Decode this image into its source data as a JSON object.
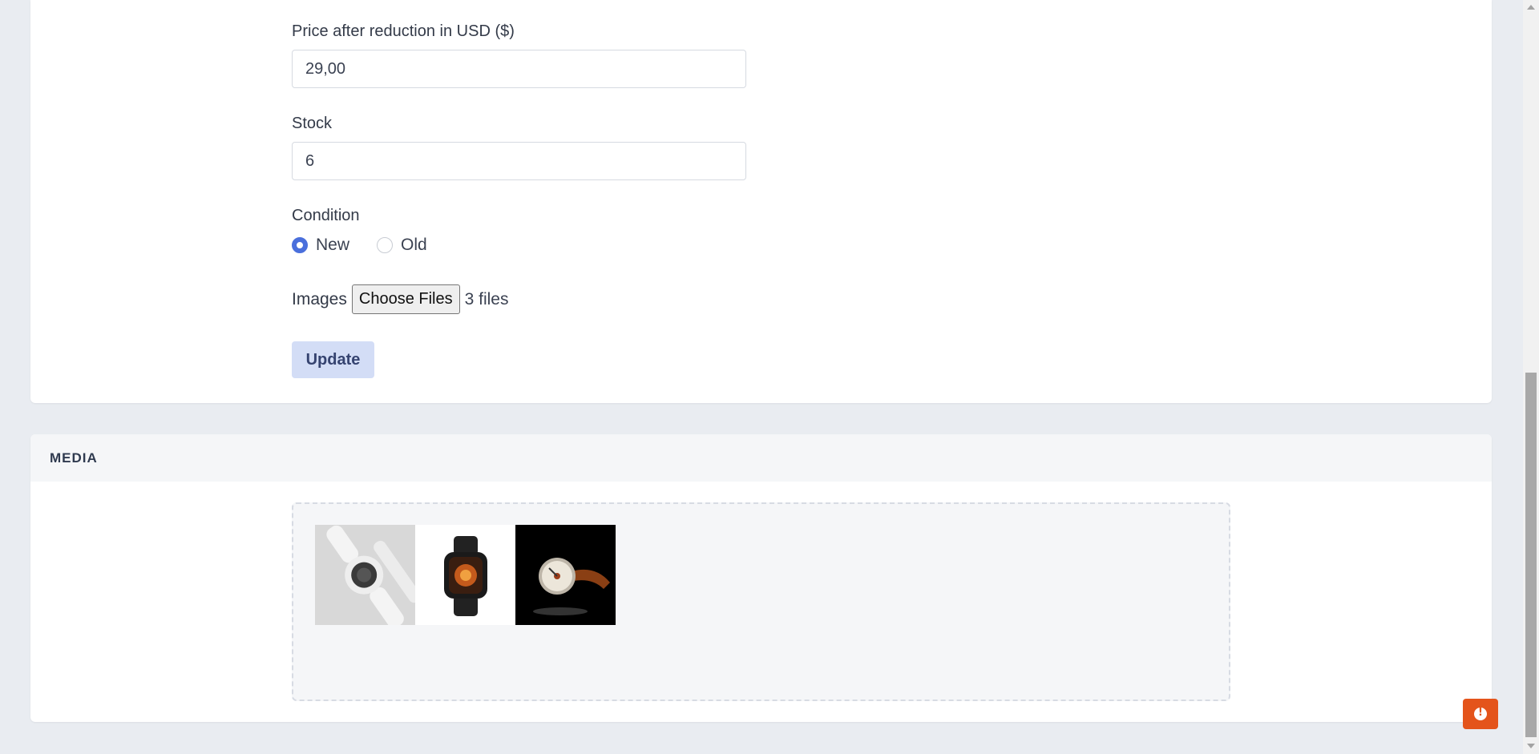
{
  "form": {
    "price_after_reduction": {
      "label": "Price after reduction in USD ($)",
      "value": "29,00"
    },
    "stock": {
      "label": "Stock",
      "value": "6"
    },
    "condition": {
      "label": "Condition",
      "options": [
        {
          "label": "New",
          "checked": true
        },
        {
          "label": "Old",
          "checked": false
        }
      ]
    },
    "images": {
      "label": "Images",
      "button_label": "Choose Files",
      "files_text": "3 files"
    },
    "update_label": "Update"
  },
  "media": {
    "title": "MEDIA",
    "thumbnails": [
      {
        "name": "white-smartwatch-thumbnail"
      },
      {
        "name": "black-smartwatch-thumbnail"
      },
      {
        "name": "leather-watch-thumbnail"
      }
    ]
  },
  "colors": {
    "accent": "#4a6fdc",
    "update_button_bg": "#d3ddf6",
    "alert_button": "#e4541b",
    "page_bg": "#e9ecf1"
  },
  "icons": {
    "fab": "alert-circle-icon"
  }
}
